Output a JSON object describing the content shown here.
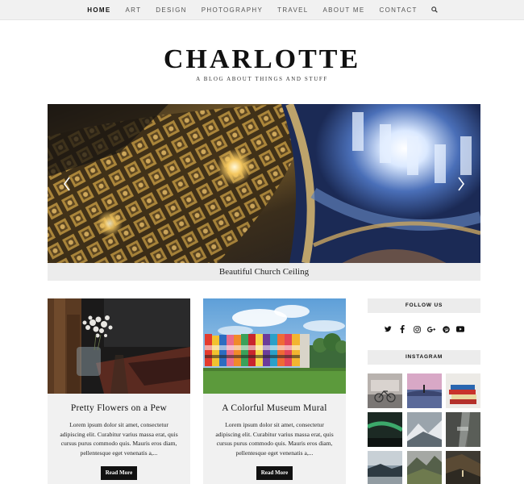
{
  "nav": {
    "items": [
      {
        "label": "HOME",
        "active": true
      },
      {
        "label": "ART",
        "active": false
      },
      {
        "label": "DESIGN",
        "active": false
      },
      {
        "label": "PHOTOGRAPHY",
        "active": false
      },
      {
        "label": "TRAVEL",
        "active": false
      },
      {
        "label": "ABOUT ME",
        "active": false
      },
      {
        "label": "CONTACT",
        "active": false
      }
    ],
    "search_icon": "search-icon"
  },
  "header": {
    "title": "CHARLOTTE",
    "tagline": "A BLOG ABOUT THINGS AND STUFF"
  },
  "slider": {
    "caption": "Beautiful Church Ceiling",
    "prev_icon": "chevron-left-icon",
    "next_icon": "chevron-right-icon"
  },
  "posts": [
    {
      "title": "Pretty Flowers on a Pew",
      "excerpt": "Lorem ipsum dolor sit amet, consectetur adipiscing elit. Curabitur varius massa erat, quis cursus purus commodo quis. Mauris eros diam, pellentesque eget venenatis a,...",
      "read_more": "Read More"
    },
    {
      "title": "A Colorful Museum Mural",
      "excerpt": "Lorem ipsum dolor sit amet, consectetur adipiscing elit. Curabitur varius massa erat, quis cursus purus commodo quis. Mauris eros diam, pellentesque eget venenatis a,...",
      "read_more": "Read More"
    }
  ],
  "sidebar": {
    "follow_title": "FOLLOW US",
    "social_icons": [
      "twitter-icon",
      "facebook-icon",
      "instagram-icon",
      "google-plus-icon",
      "pinterest-icon",
      "youtube-icon"
    ],
    "instagram_title": "INSTAGRAM"
  },
  "colors": {
    "nav_bg": "#f1f1f1",
    "caption_bg": "#ececec",
    "button_bg": "#111111",
    "text": "#222222"
  }
}
